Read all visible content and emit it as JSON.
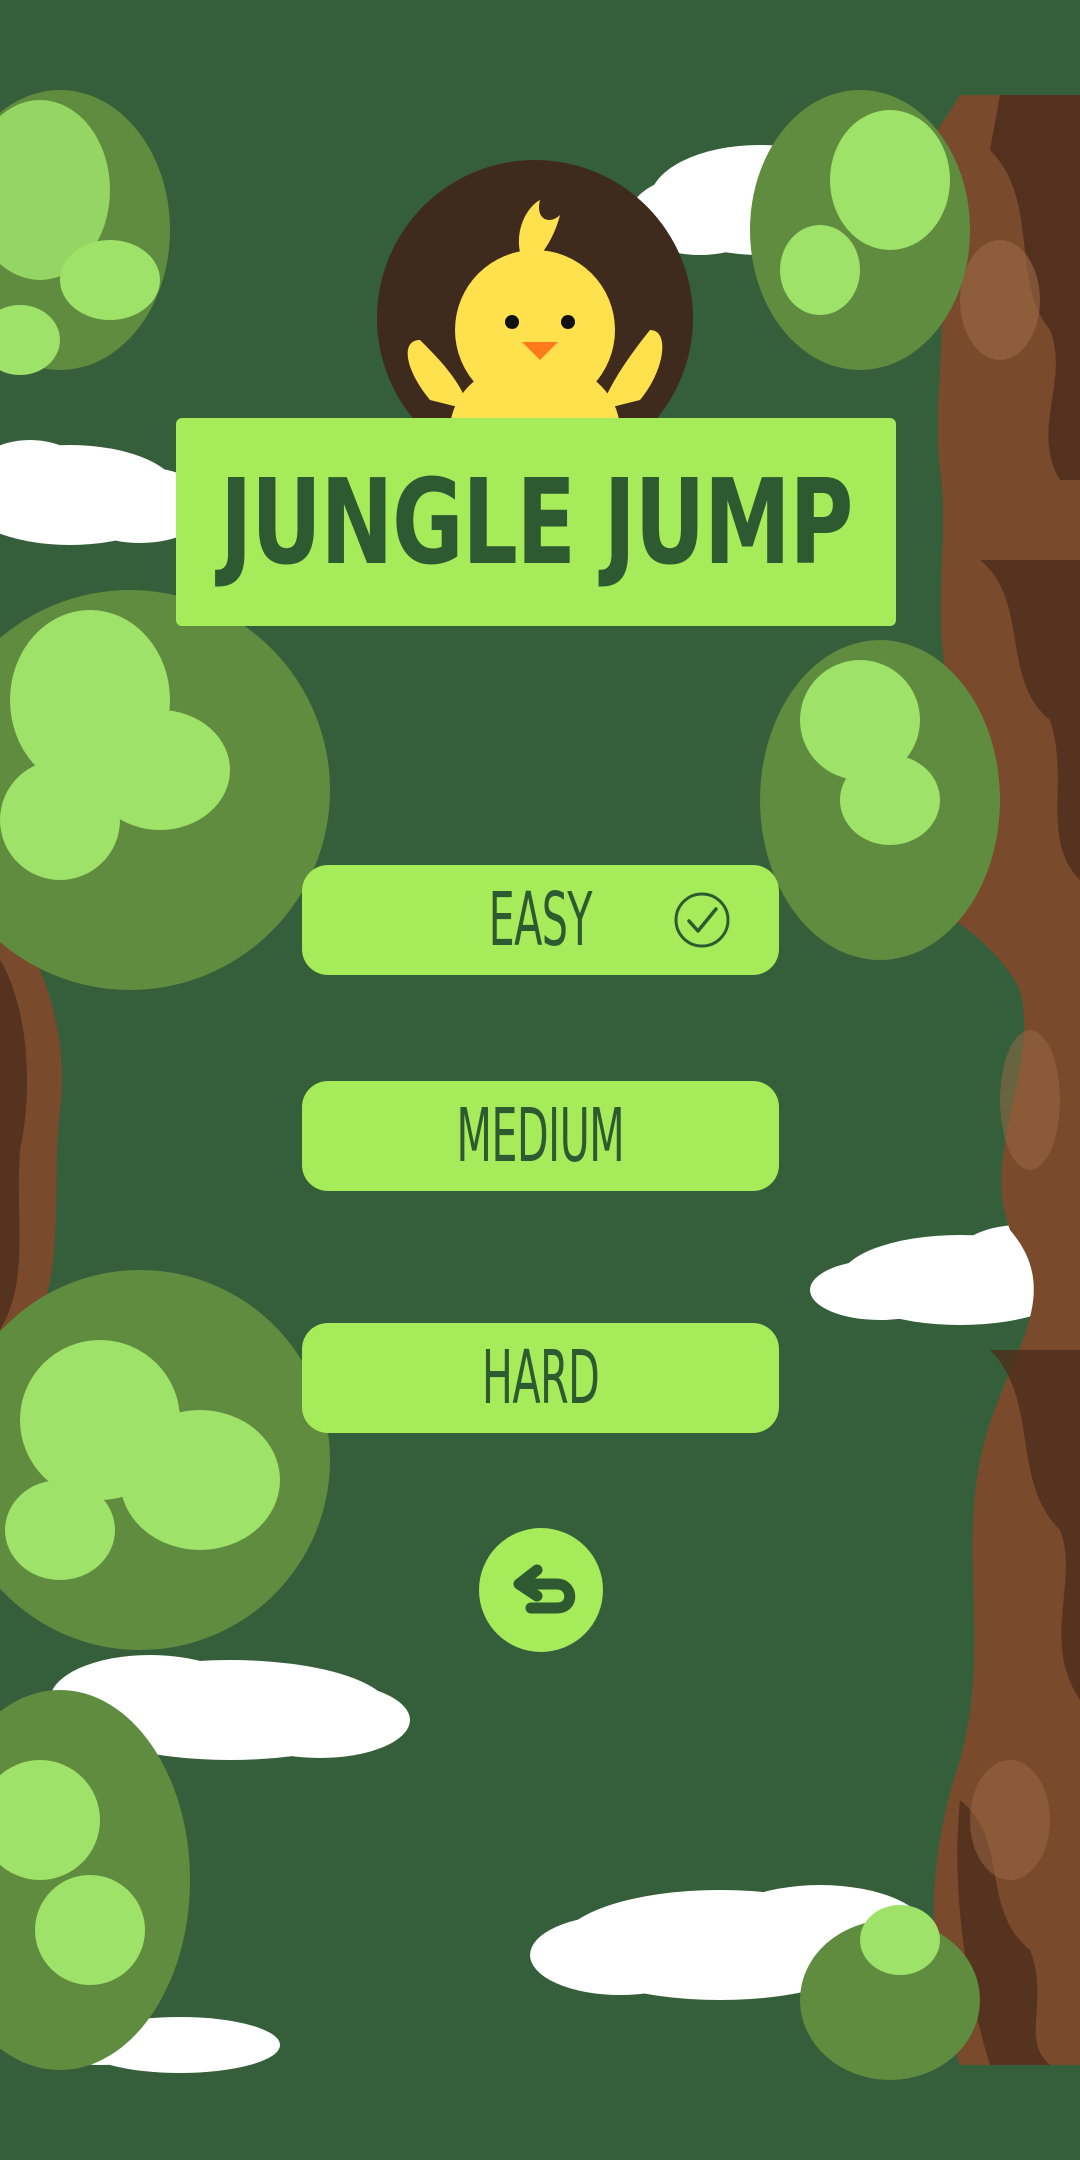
{
  "game": {
    "title": "JUNGLE JUMP"
  },
  "difficulty": {
    "options": [
      {
        "label": "EASY",
        "selected": true
      },
      {
        "label": "MEDIUM",
        "selected": false
      },
      {
        "label": "HARD",
        "selected": false
      }
    ]
  },
  "icons": {
    "selected": "check-circle-icon",
    "back": "back-arrow-icon",
    "mascot": "chick-icon"
  },
  "colors": {
    "background": "#355e3b",
    "button": "#a6eb59",
    "button_text": "#2e5a32",
    "bark": "#7a4a2c",
    "leaf_light": "#9fe26a",
    "leaf_dark": "#5f8c3f",
    "cloud": "#ffffff",
    "chick": "#ffe14d",
    "mascot_bg": "#3f2a1e"
  }
}
